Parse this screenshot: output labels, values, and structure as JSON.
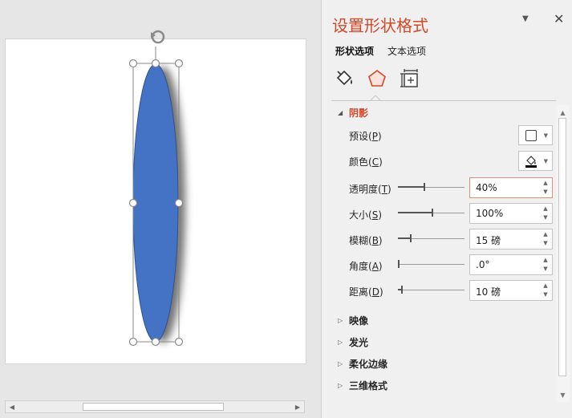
{
  "pane": {
    "title": "设置形状格式",
    "tabs": [
      {
        "label": "形状选项",
        "active": true
      },
      {
        "label": "文本选项",
        "active": false
      }
    ],
    "categories": [
      "fill-line-icon",
      "effects-pentagon-icon",
      "size-properties-icon"
    ]
  },
  "shadow": {
    "header": "阴影",
    "preset": {
      "label": "预设(",
      "key": "P",
      "suffix": ")"
    },
    "color": {
      "label": "颜色(",
      "key": "C",
      "suffix": ")"
    },
    "transparency": {
      "label": "透明度(",
      "key": "T",
      "suffix": ")",
      "value": "40%",
      "level": 0.4
    },
    "size": {
      "label": "大小(",
      "key": "S",
      "suffix": ")",
      "value": "100%",
      "level": 0.52
    },
    "blur": {
      "label": "模糊(",
      "key": "B",
      "suffix": ")",
      "value": "15 磅",
      "level": 0.18
    },
    "angle": {
      "label": "角度(",
      "key": "A",
      "suffix": ")",
      "value": ".0°",
      "level": 0.0
    },
    "distance": {
      "label": "距离(",
      "key": "D",
      "suffix": ")",
      "value": "10 磅",
      "level": 0.05
    }
  },
  "sections": {
    "reflection": "映像",
    "glow": "发光",
    "soft_edges": "柔化边缘",
    "three_d": "三维格式"
  },
  "colors": {
    "accent": "#d24726",
    "shape_fill": "#4472c4",
    "shape_stroke": "#2f528f"
  }
}
